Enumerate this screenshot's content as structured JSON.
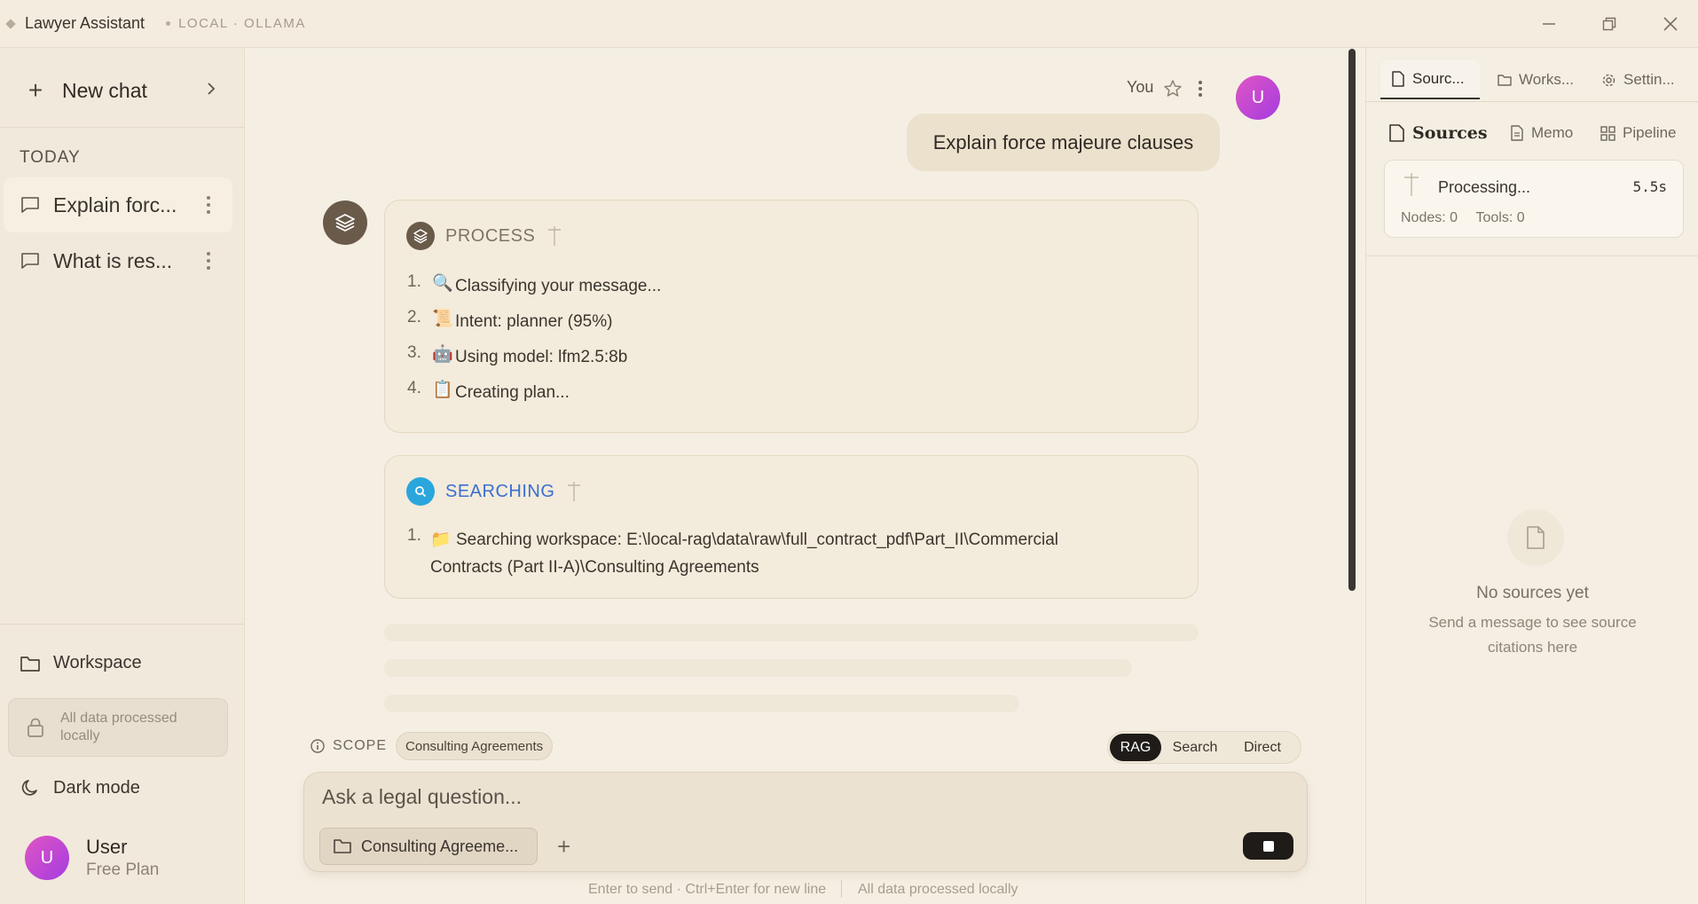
{
  "titlebar": {
    "app_title": "Lawyer Assistant",
    "subtitle": "LOCAL · OLLAMA"
  },
  "sidebar": {
    "new_chat_label": "New chat",
    "section_today": "TODAY",
    "chats": [
      {
        "label": "Explain forc...",
        "active": true
      },
      {
        "label": "What is res...",
        "active": false
      }
    ],
    "workspace_label": "Workspace",
    "local_notice": "All data processed locally",
    "dark_mode_label": "Dark mode",
    "user": {
      "initial": "U",
      "name": "User",
      "plan": "Free Plan"
    }
  },
  "chat": {
    "user_label": "You",
    "user_initial": "U",
    "user_message": "Explain force majeure clauses",
    "process": {
      "heading": "PROCESS",
      "steps": [
        {
          "num": "1.",
          "emoji": "🔍",
          "text": "Classifying your message..."
        },
        {
          "num": "2.",
          "emoji": "📜",
          "text": "Intent: planner (95%)"
        },
        {
          "num": "3.",
          "emoji": "🤖",
          "text": "Using model: lfm2.5:8b"
        },
        {
          "num": "4.",
          "emoji": "📋",
          "text": "Creating plan..."
        }
      ]
    },
    "searching": {
      "heading": "SEARCHING",
      "steps": [
        {
          "num": "1.",
          "emoji": "📁",
          "text": "Searching workspace: E:\\local-rag\\data\\raw\\full_contract_pdf\\Part_II\\Commercial",
          "text2": "Contracts (Part II-A)\\Consulting Agreements"
        }
      ]
    }
  },
  "composer": {
    "scope_label": "SCOPE",
    "scope_value": "Consulting Agreements",
    "modes": [
      "RAG",
      "Search",
      "Direct"
    ],
    "active_mode": "RAG",
    "placeholder": "Ask a legal question...",
    "folder_chip": "Consulting Agreeme...",
    "hint_left": "Enter to send · Ctrl+Enter for new line",
    "hint_right": "All data processed locally"
  },
  "right_panel": {
    "tabs": [
      "Sourc...",
      "Works...",
      "Settin..."
    ],
    "active_tab": "Sourc...",
    "subtabs": [
      "Sources",
      "Memo",
      "Pipeline"
    ],
    "active_subtab": "Sources",
    "processing": {
      "title": "Processing...",
      "time": "5.5s",
      "nodes": "Nodes: 0",
      "tools": "Tools: 0"
    },
    "empty_title": "No sources yet",
    "empty_sub": "Send a message to see source citations here"
  },
  "colors": {
    "background": "#f5efe3",
    "accent_dark": "#1e1b19",
    "avatar_gradient_start": "#e055c4",
    "avatar_gradient_end": "#a43ce0",
    "searching_blue": "#3b6fd0"
  }
}
